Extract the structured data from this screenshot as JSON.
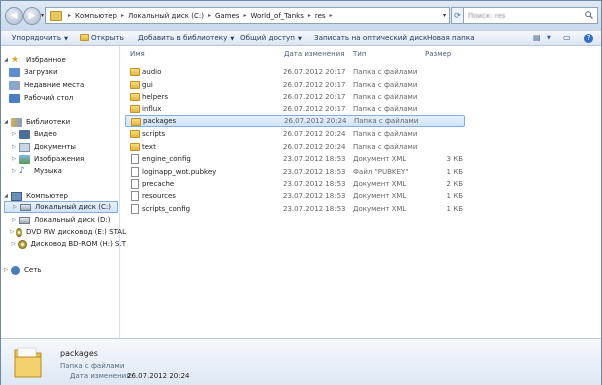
{
  "address": {
    "crumbs": [
      "Компьютер",
      "Локальный диск (C:)",
      "Games",
      "World_of_Tanks",
      "res"
    ],
    "search_placeholder": "Поиск: res"
  },
  "toolbar": {
    "organize": "Упорядочить",
    "open": "Открыть",
    "add_to_library": "Добавить в библиотеку",
    "share": "Общий доступ",
    "burn": "Записать на оптический диск",
    "new_folder": "Новая папка"
  },
  "nav": {
    "favorites": "Избранное",
    "downloads": "Загрузки",
    "recent": "Недавние места",
    "desktop": "Рабочий стол",
    "libraries": "Библиотеки",
    "video": "Видео",
    "documents": "Документы",
    "images": "Изображения",
    "music": "Музыка",
    "computer": "Компьютер",
    "disk_c": "Локальный диск (C:)",
    "disk_d": "Локальный диск (D:)",
    "dvd": "DVD RW дисковод (E:) STAL",
    "bd": "Дисковод BD-ROM (H:) S.T",
    "network": "Сеть"
  },
  "columns": {
    "name": "Имя",
    "date": "Дата изменения",
    "type": "Тип",
    "size": "Размер"
  },
  "files": [
    {
      "name": "audio",
      "date": "26.07.2012 20:17",
      "type": "Папка с файлами",
      "size": "",
      "kind": "folder"
    },
    {
      "name": "gui",
      "date": "26.07.2012 20:17",
      "type": "Папка с файлами",
      "size": "",
      "kind": "folder"
    },
    {
      "name": "helpers",
      "date": "26.07.2012 20:17",
      "type": "Папка с файлами",
      "size": "",
      "kind": "folder"
    },
    {
      "name": "influx",
      "date": "26.07.2012 20:17",
      "type": "Папка с файлами",
      "size": "",
      "kind": "folder"
    },
    {
      "name": "packages",
      "date": "26.07.2012 20:24",
      "type": "Папка с файлами",
      "size": "",
      "kind": "folder"
    },
    {
      "name": "scripts",
      "date": "26.07.2012 20:24",
      "type": "Папка с файлами",
      "size": "",
      "kind": "folder"
    },
    {
      "name": "text",
      "date": "26.07.2012 20:24",
      "type": "Папка с файлами",
      "size": "",
      "kind": "folder"
    },
    {
      "name": "engine_config",
      "date": "23.07.2012 18:53",
      "type": "Документ XML",
      "size": "3 КБ",
      "kind": "file"
    },
    {
      "name": "loginapp_wot.pubkey",
      "date": "23.07.2012 18:53",
      "type": "Файл \"PUBKEY\"",
      "size": "1 КБ",
      "kind": "file"
    },
    {
      "name": "precache",
      "date": "23.07.2012 18:53",
      "type": "Документ XML",
      "size": "2 КБ",
      "kind": "file"
    },
    {
      "name": "resources",
      "date": "23.07.2012 18:53",
      "type": "Документ XML",
      "size": "1 КБ",
      "kind": "file"
    },
    {
      "name": "scripts_config",
      "date": "23.07.2012 18:53",
      "type": "Документ XML",
      "size": "1 КБ",
      "kind": "file"
    }
  ],
  "details": {
    "name": "packages",
    "type": "Папка с файлами",
    "date_label": "Дата изменения:",
    "date_value": "26.07.2012 20:24"
  },
  "colors": {
    "selection": "#cfe3f9",
    "selection_border": "#84acdd",
    "folder": "#e6b73a"
  }
}
